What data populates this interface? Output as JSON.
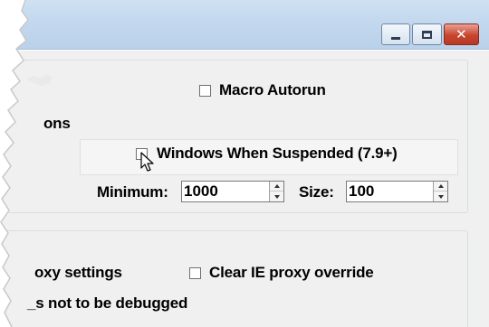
{
  "window": {
    "controls": {
      "minimize_icon": "minimize-icon",
      "maximize_icon": "maximize-icon",
      "close_icon": "close-icon",
      "close_glyph": "✕"
    }
  },
  "options": {
    "fragment_top": "ons",
    "macro_autorun_label": "Macro Autorun",
    "macro_autorun_checked": false,
    "windows_suspended_label": "Windows When Suspended (7.9+)",
    "windows_suspended_checked": false,
    "minimum_label": "Minimum:",
    "minimum_value": "1000",
    "size_label": "Size:",
    "size_value": "100"
  },
  "proxy": {
    "fragment_proxy_settings": "oxy settings",
    "clear_ie_label": "Clear IE proxy override",
    "clear_ie_checked": false,
    "fragment_not_debugged": "_s not to be debugged"
  }
}
